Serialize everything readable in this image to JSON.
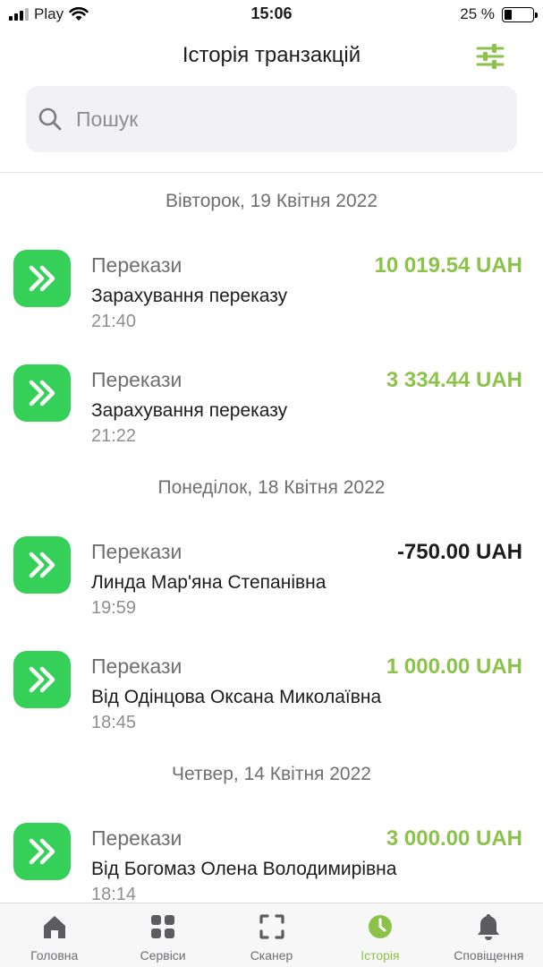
{
  "status_bar": {
    "carrier": "Play",
    "time": "15:06",
    "battery": "25 %",
    "battery_level": 0.25
  },
  "header": {
    "title": "Історія транзакцій"
  },
  "search": {
    "placeholder": "Пошук"
  },
  "colors": {
    "accent": "#8bc34a",
    "icon_green": "#34d058"
  },
  "groups": [
    {
      "date": "Вівторок, 19 Квітня 2022",
      "items": [
        {
          "category": "Перекази",
          "description": "Зарахування переказу",
          "time": "21:40",
          "amount": "10 019.54 UAH",
          "negative": false
        },
        {
          "category": "Перекази",
          "description": "Зарахування переказу",
          "time": "21:22",
          "amount": "3 334.44 UAH",
          "negative": false
        }
      ]
    },
    {
      "date": "Понеділок, 18 Квітня 2022",
      "items": [
        {
          "category": "Перекази",
          "description": "Линда Мар'яна Степанівна",
          "time": "19:59",
          "amount": "-750.00 UAH",
          "negative": true
        },
        {
          "category": "Перекази",
          "description": "Від Одінцова Оксана Миколаївна",
          "time": "18:45",
          "amount": "1 000.00 UAH",
          "negative": false
        }
      ]
    },
    {
      "date": "Четвер, 14 Квітня 2022",
      "items": [
        {
          "category": "Перекази",
          "description": "Від Богомаз Олена Володимирівна",
          "time": "18:14",
          "amount": "3 000.00 UAH",
          "negative": false
        }
      ]
    }
  ],
  "tabbar": {
    "items": [
      {
        "label": "Головна",
        "icon": "home-icon",
        "active": false
      },
      {
        "label": "Сервіси",
        "icon": "grid-icon",
        "active": false
      },
      {
        "label": "Сканер",
        "icon": "scanner-icon",
        "active": false
      },
      {
        "label": "Історія",
        "icon": "history-icon",
        "active": true
      },
      {
        "label": "Сповіщення",
        "icon": "bell-icon",
        "active": false
      }
    ]
  }
}
